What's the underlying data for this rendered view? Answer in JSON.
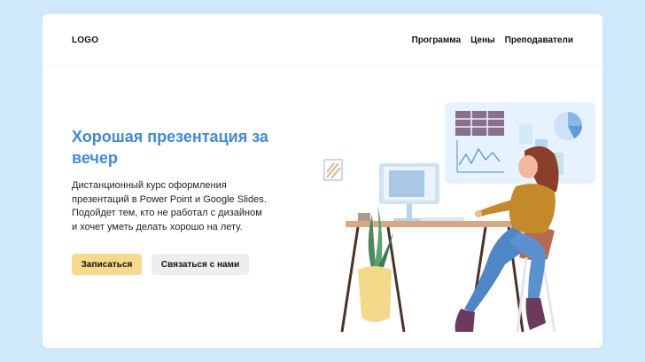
{
  "header": {
    "logo": "LOGO",
    "nav": [
      "Программа",
      "Цены",
      "Преподаватели"
    ]
  },
  "hero": {
    "title": "Хорошая презентация за вечер",
    "description": "Дистанционный курс оформления\nпрезентаций в Power Point и Google Slides.\nПодойдет тем, кто не работал с дизайном\nи хочет уметь делать хорошо на лету.",
    "primary_button": "Записаться",
    "secondary_button": "Связаться с нами"
  },
  "colors": {
    "background": "#cfe9fb",
    "accent": "#3c8ae0",
    "primary_button": "#f6d98a",
    "secondary_button": "#eeeeef"
  },
  "illustration": {
    "subject": "woman-at-computer-desk",
    "icons": [
      "bar-chart-icon",
      "line-chart-icon",
      "pie-chart-icon",
      "table-icon"
    ]
  }
}
